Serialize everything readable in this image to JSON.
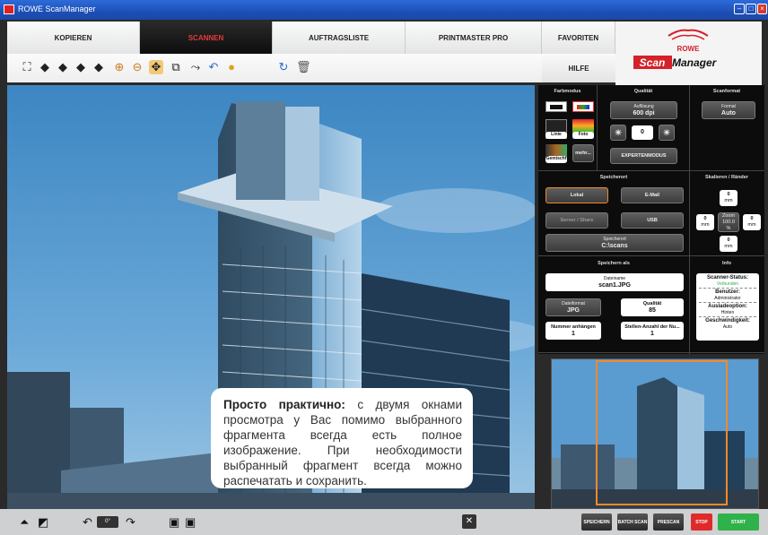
{
  "window": {
    "title": "ROWE ScanManager"
  },
  "tabs": [
    {
      "label": "KOPIEREN"
    },
    {
      "label": "SCANNEN"
    },
    {
      "label": "AUFTRAGSLISTE"
    },
    {
      "label": "PRINTMASTER PRO"
    },
    {
      "label": "FAVORITEN"
    }
  ],
  "help_label": "HILFE",
  "logo": {
    "brand": "ROWE",
    "product_a": "Scan",
    "product_b": "Manager"
  },
  "toolbar": {
    "icons": [
      "select-all-icon",
      "arrow-left-icon",
      "arrow-right-icon",
      "arrow-up-icon",
      "arrow-down-icon",
      "zoom-in-icon",
      "zoom-out-icon",
      "fit-icon",
      "crop-icon",
      "measure-icon",
      "undo-icon",
      "color-icon",
      "reload-icon",
      "trash-icon"
    ]
  },
  "callout": {
    "bold": "Просто практично:",
    "text": " с двумя окнами просмотра у Вас помимо выбранного фрагмента всегда есть полное изображение. При необходимости выбранный фрагмент всегда можно распечатать и сохранить."
  },
  "panel": {
    "farbmodus": {
      "title": "Farbmodus",
      "linie": "Linie",
      "foto": "Foto",
      "gemischt": "Gemischt",
      "mehr": "mehr..."
    },
    "qualitat": {
      "title": "Qualität",
      "aufl_label": "Auflösung",
      "aufl_value": "600 dpi",
      "brightness": "0",
      "expert": "EXPERTENMODUS"
    },
    "scanformat": {
      "title": "Scanformat",
      "format_label": "Format",
      "format_value": "Auto"
    },
    "speicherort": {
      "title": "Speicherort",
      "lokal": "Lokal",
      "email": "E-Mail",
      "server": "Server / Share",
      "usb": "USB",
      "path_label": "Speicherort",
      "path_value": "C:\\scans"
    },
    "skalieren": {
      "title": "Skalieren / Ränder",
      "top": "0",
      "right": "0",
      "bottom": "0",
      "left": "0",
      "unit": "mm",
      "zoom_label": "Zoom",
      "zoom_value": "100.0",
      "zoom_unit": "%"
    },
    "speichern": {
      "title": "Speichern als",
      "dateiname_label": "Dateiname",
      "dateiname_value": "scan1.JPG",
      "format_label": "Dateiformat",
      "format_value": "JPG",
      "qualitaet_label": "Qualität",
      "qualitaet_value": "85",
      "nummer_label": "Nummer anhängen",
      "nummer_value": "1",
      "stellen_label": "Stellen-Anzahl der Nu...",
      "stellen_value": "1"
    },
    "info": {
      "title": "Info",
      "status_label": "Scanner-Status:",
      "status_value": "Verbunden",
      "benutzer_label": "Benutzer:",
      "benutzer_value": "Administrator",
      "ausgabe_label": "Ausladeoption:",
      "ausgabe_value": "Hinten",
      "speed_label": "Geschwindigkeit:",
      "speed_value": "Auto"
    }
  },
  "bottom": {
    "rotate_value": "0°",
    "speichern": "SPEICHERN",
    "batch": "BATCH SCAN",
    "prescan": "PRESCAN",
    "stop": "STOP",
    "start": "START"
  },
  "colors": {
    "accent_red": "#e53a3a",
    "stop_red": "#e02a2a",
    "start_green": "#2fb24a",
    "orange_selection": "#f08a2a"
  }
}
